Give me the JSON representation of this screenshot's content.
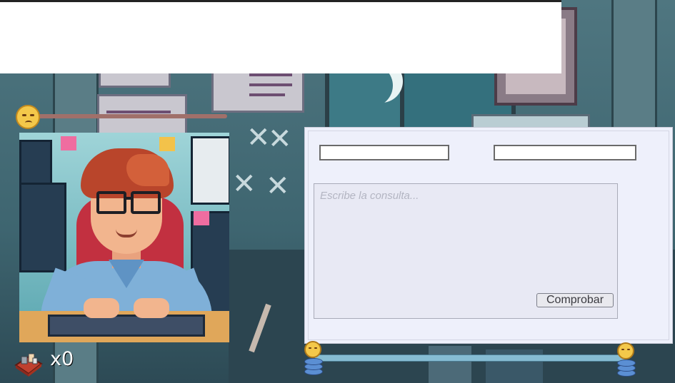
{
  "hud": {
    "item_count_text": "x0",
    "mood_level": 0.0,
    "progress_level": 0.0
  },
  "query_panel": {
    "placeholder": "Escribe la consulta...",
    "check_button_label": "Comprobar"
  },
  "icons": {
    "mood": "worried-face-icon",
    "item": "toolbox-icon",
    "progress_start": "coin-stack-icon",
    "progress_end": "coin-stack-icon"
  },
  "colors": {
    "panel_bg": "#eef0fb",
    "mood_track": "#a0706a",
    "progress_track": "#86bcd3"
  }
}
